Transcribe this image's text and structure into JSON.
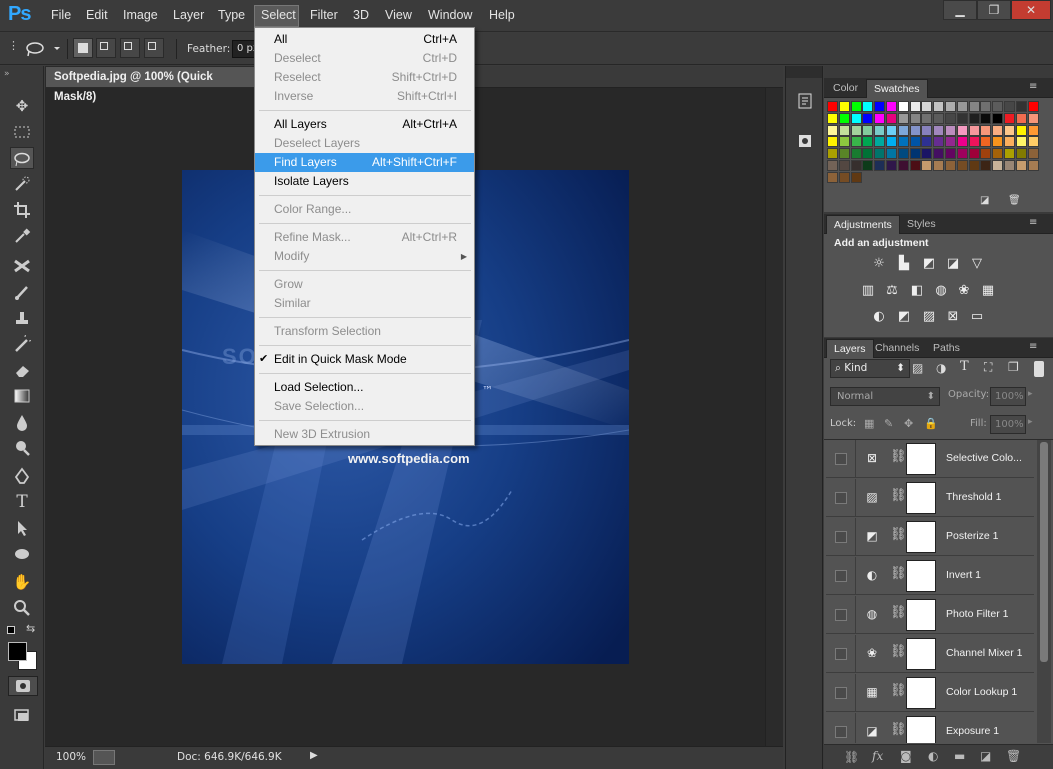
{
  "app": {
    "logo": "Ps"
  },
  "menubar": {
    "items": [
      "File",
      "Edit",
      "Image",
      "Layer",
      "Type",
      "Select",
      "Filter",
      "3D",
      "View",
      "Window",
      "Help"
    ],
    "window_controls": {
      "minimize": "▁",
      "restore": "❐",
      "close": "✕"
    }
  },
  "options_bar": {
    "feather_label": "Feather:",
    "feather_value": "0 px"
  },
  "document": {
    "tab_title": "Softpedia.jpg @ 100% (Quick Mask/8)",
    "canvas_text_url": "www.softpedia.com",
    "canvas_watermark": "SOFTPEDIA",
    "canvas_tm": "™"
  },
  "status_bar": {
    "zoom": "100%",
    "doc_info": "Doc: 646.9K/646.9K"
  },
  "select_menu": {
    "items": [
      {
        "label": "All",
        "shortcut": "Ctrl+A",
        "enabled": true
      },
      {
        "label": "Deselect",
        "shortcut": "Ctrl+D",
        "enabled": false
      },
      {
        "label": "Reselect",
        "shortcut": "Shift+Ctrl+D",
        "enabled": false
      },
      {
        "label": "Inverse",
        "shortcut": "Shift+Ctrl+I",
        "enabled": false
      },
      {
        "label": "All Layers",
        "shortcut": "Alt+Ctrl+A",
        "enabled": true
      },
      {
        "label": "Deselect Layers",
        "shortcut": "",
        "enabled": false
      },
      {
        "label": "Find Layers",
        "shortcut": "Alt+Shift+Ctrl+F",
        "enabled": true,
        "highlighted": true
      },
      {
        "label": "Isolate Layers",
        "shortcut": "",
        "enabled": true
      },
      {
        "label": "Color Range...",
        "shortcut": "",
        "enabled": false
      },
      {
        "label": "Refine Mask...",
        "shortcut": "Alt+Ctrl+R",
        "enabled": false
      },
      {
        "label": "Modify",
        "shortcut": "",
        "enabled": false,
        "submenu": true
      },
      {
        "label": "Grow",
        "shortcut": "",
        "enabled": false
      },
      {
        "label": "Similar",
        "shortcut": "",
        "enabled": false
      },
      {
        "label": "Transform Selection",
        "shortcut": "",
        "enabled": false
      },
      {
        "label": "Edit in Quick Mask Mode",
        "shortcut": "",
        "enabled": true,
        "checked": true
      },
      {
        "label": "Load Selection...",
        "shortcut": "",
        "enabled": true
      },
      {
        "label": "Save Selection...",
        "shortcut": "",
        "enabled": false
      },
      {
        "label": "New 3D Extrusion",
        "shortcut": "",
        "enabled": false
      }
    ]
  },
  "color_panel": {
    "tabs": [
      "Color",
      "Swatches"
    ],
    "active_tab": "Swatches"
  },
  "swatches": {
    "rows": [
      [
        "#ff0000",
        "#ffff00",
        "#00ff00",
        "#00ffff",
        "#0000ff",
        "#ff00ff",
        "#ffffff",
        "#ebebeb",
        "#d6d6d6",
        "#c2c2c2",
        "#adadad",
        "#999999",
        "#858585",
        "#707070",
        "#5c5c5c",
        "#474747",
        "#333333",
        "#ff0000"
      ],
      [
        "#ffff00",
        "#00ff00",
        "#00ffff",
        "#0000ff",
        "#ff00ff",
        "#e6007e",
        "#999999",
        "#858585",
        "#707070",
        "#5c5c5c",
        "#474747",
        "#333333",
        "#1f1f1f",
        "#0a0a0a",
        "#000000",
        "#ed1c24",
        "#f26c4f",
        "#f69679"
      ],
      [
        "#fff799",
        "#c4df9b",
        "#a3d39c",
        "#82ca9c",
        "#7accc8",
        "#6dcff6",
        "#7da7d9",
        "#8393ca",
        "#8781bd",
        "#a187be",
        "#bc8dbf",
        "#f49ac1",
        "#f5989d",
        "#f7977a",
        "#f9ad81",
        "#fdc68a",
        "#fff200",
        "#ff9933"
      ],
      [
        "#fff200",
        "#8dc73f",
        "#39b54a",
        "#00a651",
        "#00a99d",
        "#00aeef",
        "#0072bc",
        "#0054a6",
        "#2e3192",
        "#662d91",
        "#92278f",
        "#ec008c",
        "#ed145b",
        "#f26522",
        "#f7941d",
        "#fbaf5d",
        "#fff568",
        "#ffcc66"
      ],
      [
        "#aba000",
        "#598527",
        "#197b30",
        "#007236",
        "#00746b",
        "#0076a3",
        "#004a80",
        "#003471",
        "#1b1464",
        "#440e62",
        "#630460",
        "#9e005d",
        "#9e0039",
        "#a0410d",
        "#a36209",
        "#aba000",
        "#827b00",
        "#8c6239"
      ],
      [
        "#736357",
        "#534741",
        "#362f2d",
        "#0d3b1a",
        "#1d2e56",
        "#2f174a",
        "#3e0f31",
        "#4c0e15",
        "#c69c6d",
        "#a67c52",
        "#8c6239",
        "#754c24",
        "#603913",
        "#3c2415",
        "#c7b299",
        "#998675",
        "#c69c6d",
        "#a67c52"
      ],
      [
        "#8c6239",
        "#754c24",
        "#603913"
      ]
    ]
  },
  "adjustments_panel": {
    "tabs": [
      "Adjustments",
      "Styles"
    ],
    "active_tab": "Adjustments",
    "heading": "Add an adjustment",
    "icons_row1": [
      "brightness-icon",
      "levels-icon",
      "curves-icon",
      "exposure-icon",
      "vibrance-icon"
    ],
    "icons_row2": [
      "hue-saturation-icon",
      "color-balance-icon",
      "black-white-icon",
      "photo-filter-icon",
      "channel-mixer-icon",
      "color-lookup-icon"
    ],
    "icons_row3": [
      "invert-icon",
      "posterize-icon",
      "threshold-icon",
      "selective-color-icon",
      "gradient-map-icon"
    ]
  },
  "layers_panel": {
    "tabs": [
      "Layers",
      "Channels",
      "Paths"
    ],
    "active_tab": "Layers",
    "filter_label": "Kind",
    "blend_mode": "Normal",
    "opacity_label": "Opacity:",
    "opacity_value": "100%",
    "lock_label": "Lock:",
    "fill_label": "Fill:",
    "fill_value": "100%",
    "layers": [
      {
        "name": "Selective Colo...",
        "icon": "selective-color-icon"
      },
      {
        "name": "Threshold 1",
        "icon": "threshold-icon"
      },
      {
        "name": "Posterize 1",
        "icon": "posterize-icon"
      },
      {
        "name": "Invert 1",
        "icon": "invert-icon"
      },
      {
        "name": "Photo Filter 1",
        "icon": "photo-filter-icon"
      },
      {
        "name": "Channel Mixer 1",
        "icon": "channel-mixer-icon"
      },
      {
        "name": "Color Lookup 1",
        "icon": "color-lookup-icon"
      },
      {
        "name": "Exposure 1",
        "icon": "exposure-icon"
      }
    ]
  }
}
